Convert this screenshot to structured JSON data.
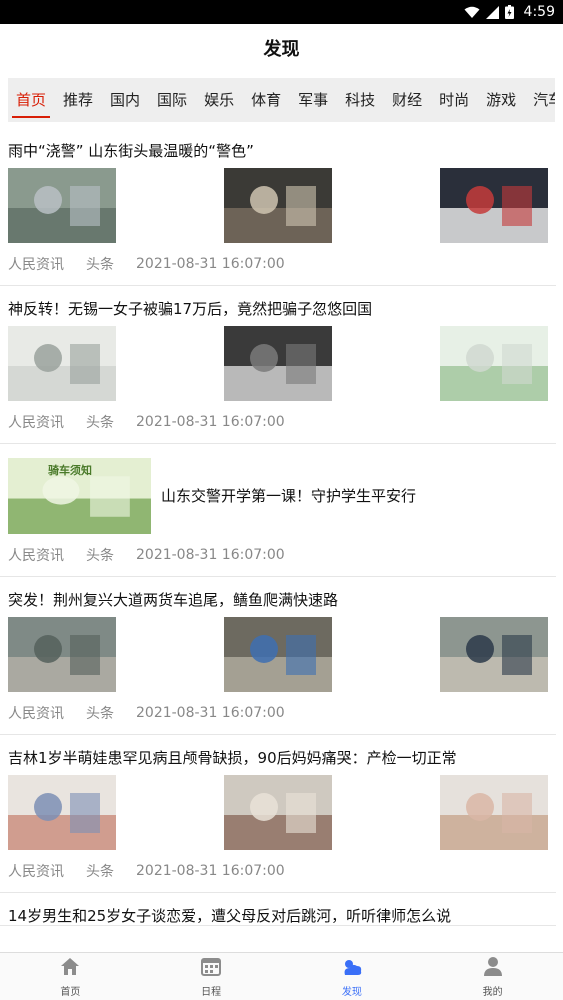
{
  "status_bar": {
    "time": "4:59"
  },
  "header": {
    "title": "发现"
  },
  "tabs": [
    {
      "label": "首页",
      "active": true
    },
    {
      "label": "推荐"
    },
    {
      "label": "国内"
    },
    {
      "label": "国际"
    },
    {
      "label": "娱乐"
    },
    {
      "label": "体育"
    },
    {
      "label": "军事"
    },
    {
      "label": "科技"
    },
    {
      "label": "财经"
    },
    {
      "label": "时尚"
    },
    {
      "label": "游戏"
    },
    {
      "label": "汽车"
    }
  ],
  "news": [
    {
      "title": "雨中“浇警” 山东街头最温暖的“警色”",
      "source": "人民资讯",
      "category": "头条",
      "time": "2021-08-31 16:07:00",
      "layout": "triple"
    },
    {
      "title": "神反转！无锡一女子被骗17万后，竟然把骗子忽悠回国",
      "source": "人民资讯",
      "category": "头条",
      "time": "2021-08-31 16:07:00",
      "layout": "triple"
    },
    {
      "title": "山东交警开学第一课！守护学生平安行",
      "source": "人民资讯",
      "category": "头条",
      "time": "2021-08-31 16:07:00",
      "layout": "single",
      "thumb_text": "骑车须知"
    },
    {
      "title": "突发！荆州复兴大道两货车追尾，鳝鱼爬满快速路",
      "source": "人民资讯",
      "category": "头条",
      "time": "2021-08-31 16:07:00",
      "layout": "triple"
    },
    {
      "title": "吉林1岁半萌娃患罕见病且颅骨缺损，90后妈妈痛哭：产检一切正常",
      "source": "人民资讯",
      "category": "头条",
      "time": "2021-08-31 16:07:00",
      "layout": "triple"
    },
    {
      "title": "14岁男生和25岁女子谈恋爱，遭父母反对后跳河，听听律师怎么说"
    }
  ],
  "bottom_nav": [
    {
      "label": "首页",
      "icon": "home-icon"
    },
    {
      "label": "日程",
      "icon": "calendar-icon"
    },
    {
      "label": "发现",
      "icon": "discover-icon",
      "active": true
    },
    {
      "label": "我的",
      "icon": "user-icon"
    }
  ],
  "colors": {
    "accent": "#d81e06",
    "nav_active": "#3a6ff7",
    "tab_bg": "#eeeeee"
  }
}
